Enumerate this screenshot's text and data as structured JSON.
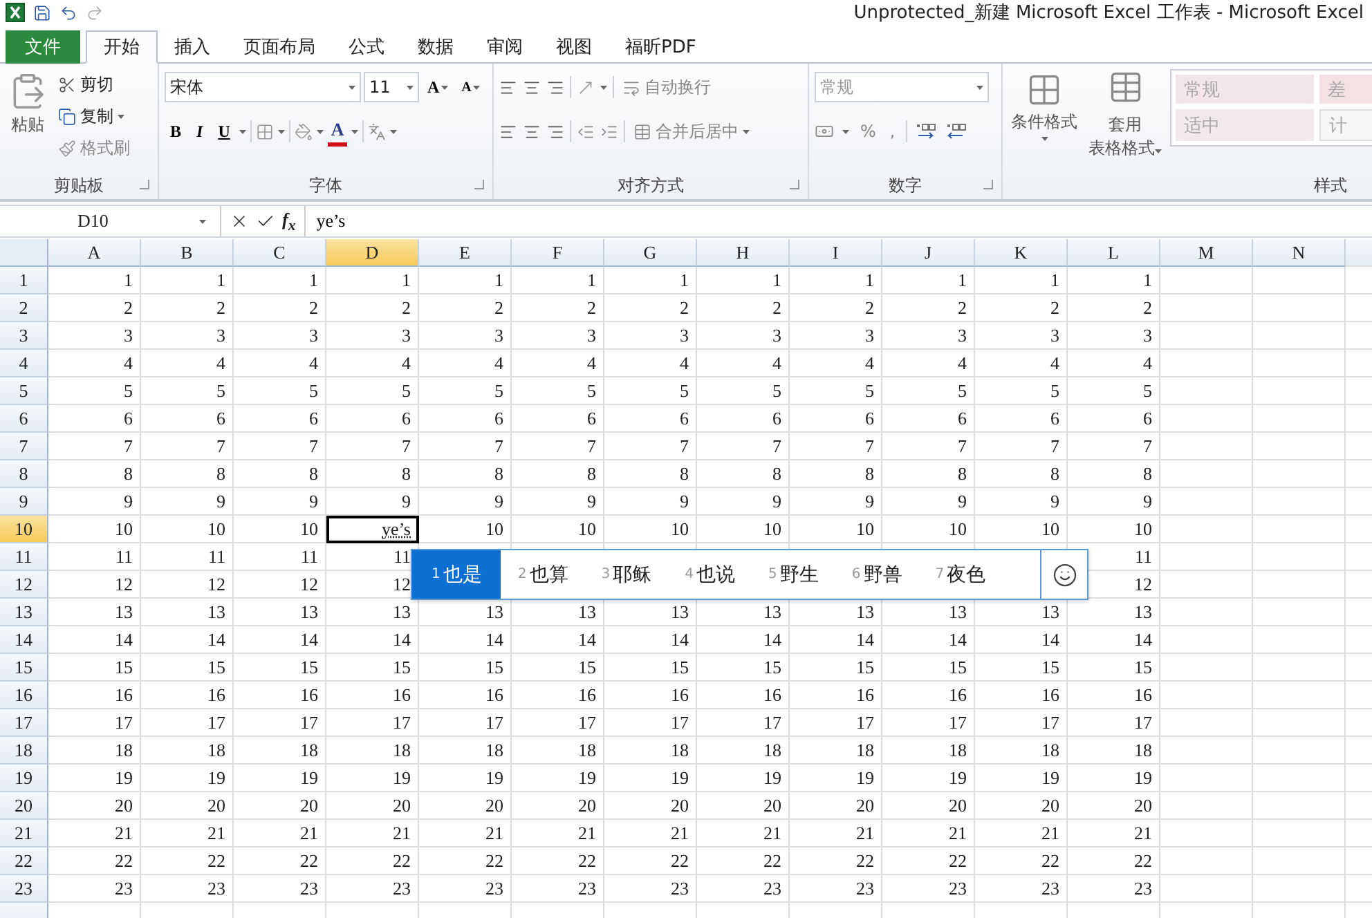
{
  "window": {
    "title": "Unprotected_新建 Microsoft Excel 工作表 - Microsoft Excel"
  },
  "tabs": [
    {
      "label": "文件",
      "kind": "file",
      "selected": false
    },
    {
      "label": "开始",
      "kind": "tab",
      "selected": true
    },
    {
      "label": "插入",
      "kind": "tab",
      "selected": false
    },
    {
      "label": "页面布局",
      "kind": "tab",
      "selected": false
    },
    {
      "label": "公式",
      "kind": "tab",
      "selected": false
    },
    {
      "label": "数据",
      "kind": "tab",
      "selected": false
    },
    {
      "label": "审阅",
      "kind": "tab",
      "selected": false
    },
    {
      "label": "视图",
      "kind": "tab",
      "selected": false
    },
    {
      "label": "福昕PDF",
      "kind": "tab",
      "selected": false
    }
  ],
  "ribbon": {
    "clipboard": {
      "label": "剪贴板",
      "paste": "粘贴",
      "cut": "剪切",
      "copy": "复制",
      "format_painter": "格式刷"
    },
    "font": {
      "label": "字体",
      "font_name": "宋体",
      "font_size": "11",
      "grow": "A",
      "shrink": "A",
      "bold": "B",
      "italic": "I",
      "underline": "U",
      "font_color": "A"
    },
    "alignment": {
      "label": "对齐方式",
      "wrap_text": "自动换行",
      "merge_center": "合并后居中"
    },
    "number": {
      "label": "数字",
      "format": "常规",
      "percent": "%",
      "comma": ","
    },
    "styles": {
      "label": "样式",
      "conditional_formatting": "条件格式",
      "format_as_table": "套用",
      "format_as_table_2": "表格格式",
      "gallery": [
        {
          "label": "常规",
          "color": "#f2e6ea"
        },
        {
          "label": "差",
          "color": "#f4e1e4"
        },
        {
          "label": "适中",
          "color": "#f1e9eb"
        },
        {
          "label": "计",
          "color": "#f6f6f6"
        }
      ]
    }
  },
  "formula_bar": {
    "name_box": "D10",
    "fx": "f$_{x}$",
    "value": "ye’s"
  },
  "sheet": {
    "columns": [
      {
        "label": "A",
        "selected": false
      },
      {
        "label": "B",
        "selected": false
      },
      {
        "label": "C",
        "selected": false
      },
      {
        "label": "D",
        "selected": true
      },
      {
        "label": "E",
        "selected": false
      },
      {
        "label": "F",
        "selected": false
      },
      {
        "label": "G",
        "selected": false
      },
      {
        "label": "H",
        "selected": false
      },
      {
        "label": "I",
        "selected": false
      },
      {
        "label": "J",
        "selected": false
      },
      {
        "label": "K",
        "selected": false
      },
      {
        "label": "L",
        "selected": false
      },
      {
        "label": "M",
        "selected": false
      },
      {
        "label": "N",
        "selected": false
      }
    ],
    "rows": [
      {
        "label": "1",
        "selected": false,
        "cells": [
          "1",
          "1",
          "1",
          "1",
          "1",
          "1",
          "1",
          "1",
          "1",
          "1",
          "1",
          "1"
        ]
      },
      {
        "label": "2",
        "selected": false,
        "cells": [
          "2",
          "2",
          "2",
          "2",
          "2",
          "2",
          "2",
          "2",
          "2",
          "2",
          "2",
          "2"
        ]
      },
      {
        "label": "3",
        "selected": false,
        "cells": [
          "3",
          "3",
          "3",
          "3",
          "3",
          "3",
          "3",
          "3",
          "3",
          "3",
          "3",
          "3"
        ]
      },
      {
        "label": "4",
        "selected": false,
        "cells": [
          "4",
          "4",
          "4",
          "4",
          "4",
          "4",
          "4",
          "4",
          "4",
          "4",
          "4",
          "4"
        ]
      },
      {
        "label": "5",
        "selected": false,
        "cells": [
          "5",
          "5",
          "5",
          "5",
          "5",
          "5",
          "5",
          "5",
          "5",
          "5",
          "5",
          "5"
        ]
      },
      {
        "label": "6",
        "selected": false,
        "cells": [
          "6",
          "6",
          "6",
          "6",
          "6",
          "6",
          "6",
          "6",
          "6",
          "6",
          "6",
          "6"
        ]
      },
      {
        "label": "7",
        "selected": false,
        "cells": [
          "7",
          "7",
          "7",
          "7",
          "7",
          "7",
          "7",
          "7",
          "7",
          "7",
          "7",
          "7"
        ]
      },
      {
        "label": "8",
        "selected": false,
        "cells": [
          "8",
          "8",
          "8",
          "8",
          "8",
          "8",
          "8",
          "8",
          "8",
          "8",
          "8",
          "8"
        ]
      },
      {
        "label": "9",
        "selected": false,
        "cells": [
          "9",
          "9",
          "9",
          "9",
          "9",
          "9",
          "9",
          "9",
          "9",
          "9",
          "9",
          "9"
        ]
      },
      {
        "label": "10",
        "selected": true,
        "cells": [
          "10",
          "10",
          "10",
          "ye’s",
          "10",
          "10",
          "10",
          "10",
          "10",
          "10",
          "10",
          "10"
        ]
      },
      {
        "label": "11",
        "selected": false,
        "cells": [
          "11",
          "11",
          "11",
          "11",
          null,
          null,
          null,
          null,
          null,
          null,
          null,
          "11"
        ]
      },
      {
        "label": "12",
        "selected": false,
        "cells": [
          "12",
          "12",
          "12",
          "12",
          null,
          null,
          null,
          null,
          null,
          null,
          null,
          "12"
        ]
      },
      {
        "label": "13",
        "selected": false,
        "cells": [
          "13",
          "13",
          "13",
          "13",
          "13",
          "13",
          "13",
          "13",
          "13",
          "13",
          "13",
          "13"
        ]
      },
      {
        "label": "14",
        "selected": false,
        "cells": [
          "14",
          "14",
          "14",
          "14",
          "14",
          "14",
          "14",
          "14",
          "14",
          "14",
          "14",
          "14"
        ]
      },
      {
        "label": "15",
        "selected": false,
        "cells": [
          "15",
          "15",
          "15",
          "15",
          "15",
          "15",
          "15",
          "15",
          "15",
          "15",
          "15",
          "15"
        ]
      },
      {
        "label": "16",
        "selected": false,
        "cells": [
          "16",
          "16",
          "16",
          "16",
          "16",
          "16",
          "16",
          "16",
          "16",
          "16",
          "16",
          "16"
        ]
      },
      {
        "label": "17",
        "selected": false,
        "cells": [
          "17",
          "17",
          "17",
          "17",
          "17",
          "17",
          "17",
          "17",
          "17",
          "17",
          "17",
          "17"
        ]
      },
      {
        "label": "18",
        "selected": false,
        "cells": [
          "18",
          "18",
          "18",
          "18",
          "18",
          "18",
          "18",
          "18",
          "18",
          "18",
          "18",
          "18"
        ]
      },
      {
        "label": "19",
        "selected": false,
        "cells": [
          "19",
          "19",
          "19",
          "19",
          "19",
          "19",
          "19",
          "19",
          "19",
          "19",
          "19",
          "19"
        ]
      },
      {
        "label": "20",
        "selected": false,
        "cells": [
          "20",
          "20",
          "20",
          "20",
          "20",
          "20",
          "20",
          "20",
          "20",
          "20",
          "20",
          "20"
        ]
      },
      {
        "label": "21",
        "selected": false,
        "cells": [
          "21",
          "21",
          "21",
          "21",
          "21",
          "21",
          "21",
          "21",
          "21",
          "21",
          "21",
          "21"
        ]
      },
      {
        "label": "22",
        "selected": false,
        "cells": [
          "22",
          "22",
          "22",
          "22",
          "22",
          "22",
          "22",
          "22",
          "22",
          "22",
          "22",
          "22"
        ]
      },
      {
        "label": "23",
        "selected": false,
        "cells": [
          "23",
          "23",
          "23",
          "23",
          "23",
          "23",
          "23",
          "23",
          "23",
          "23",
          "23",
          "23"
        ]
      }
    ]
  },
  "ime": {
    "candidates": [
      {
        "index": "1",
        "text": "也是",
        "selected": true
      },
      {
        "index": "2",
        "text": "也算",
        "selected": false
      },
      {
        "index": "3",
        "text": "耶稣",
        "selected": false
      },
      {
        "index": "4",
        "text": "也说",
        "selected": false
      },
      {
        "index": "5",
        "text": "野生",
        "selected": false
      },
      {
        "index": "6",
        "text": "野兽",
        "selected": false
      },
      {
        "index": "7",
        "text": "夜色",
        "selected": false
      }
    ]
  }
}
